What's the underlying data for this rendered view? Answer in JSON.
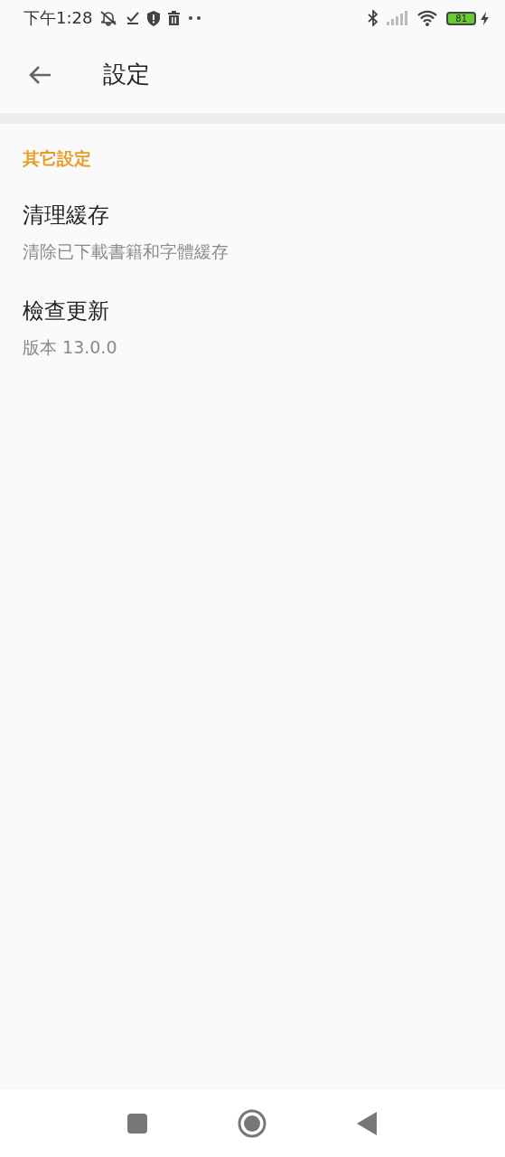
{
  "status_bar": {
    "time": "下午1:28",
    "battery": "81"
  },
  "app_bar": {
    "title": "設定"
  },
  "section": {
    "title": "其它設定"
  },
  "items": [
    {
      "title": "清理緩存",
      "subtitle": "清除已下載書籍和字體緩存"
    },
    {
      "title": "檢查更新",
      "subtitle": "版本 13.0.0"
    }
  ]
}
